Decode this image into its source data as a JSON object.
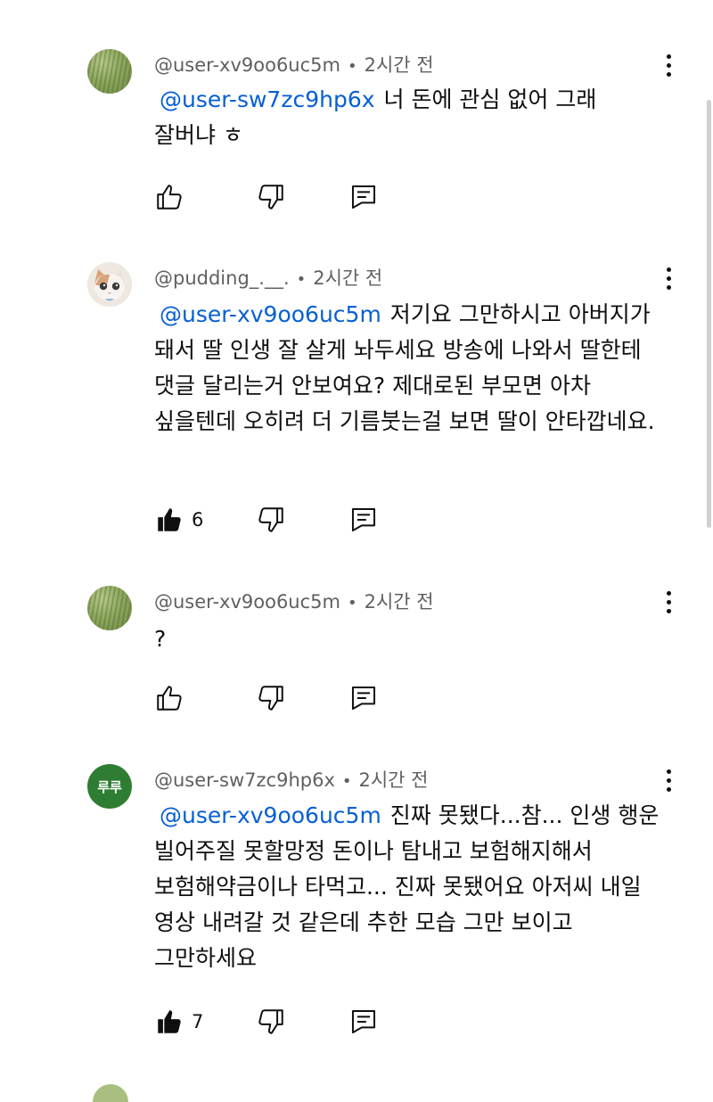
{
  "comments": [
    {
      "handle": "@user-xv9oo6uc5m",
      "time": "2시간 전",
      "avatar": "grass-avatar",
      "mention": "@user-sw7zc9hp6x",
      "text": "너 돈에 관심 없어 그래 잘버냐 ㅎ",
      "likes": "",
      "liked": false
    },
    {
      "handle": "@pudding_.__.",
      "time": "2시간 전",
      "avatar": "cat-avatar",
      "mention": "@user-xv9oo6uc5m",
      "text": "저기요 그만하시고 아버지가 돼서 딸 인생 잘 살게 놔두세요 방송에 나와서 딸한테 댓글 달리는거 안보여요? 제대로된 부모면 아차 싶을텐데 오히려 더 기름붓는걸 보면 딸이 안타깝네요.",
      "likes": "6",
      "liked": true
    },
    {
      "handle": "@user-xv9oo6uc5m",
      "time": "2시간 전",
      "avatar": "grass-avatar",
      "mention": "",
      "text": "?",
      "likes": "",
      "liked": false
    },
    {
      "handle": "@user-sw7zc9hp6x",
      "time": "2시간 전",
      "avatar": "initials-avatar",
      "avatar_text": "루루",
      "mention": "@user-xv9oo6uc5m",
      "text": "진짜 못됐다...참... 인생 행운 빌어주질 못할망정 돈이나 탐내고 보험해지해서 보험해약금이나 타먹고... 진짜 못됐어요 아저씨 내일 영상 내려갈 것 같은데 추한 모습 그만 보이고 그만하세요",
      "likes": "7",
      "liked": true
    }
  ],
  "icons": {
    "like": "thumbs-up-icon",
    "dislike": "thumbs-down-icon",
    "reply": "reply-icon",
    "menu": "more-vertical-icon"
  },
  "colors": {
    "mention": "#065fd4",
    "meta": "#606060",
    "initials_avatar": "#2e7d32"
  }
}
